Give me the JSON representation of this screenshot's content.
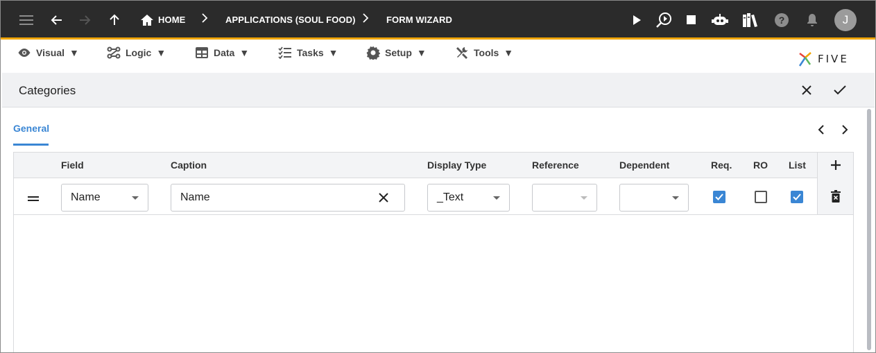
{
  "topbar": {
    "breadcrumbs": [
      "HOME",
      "APPLICATIONS (SOUL FOOD)",
      "FORM WIZARD"
    ],
    "avatar_initial": "J",
    "accent": "#f0a500"
  },
  "menu": {
    "items": [
      {
        "label": "Visual",
        "icon": "eye-icon"
      },
      {
        "label": "Logic",
        "icon": "logic-icon"
      },
      {
        "label": "Data",
        "icon": "table-icon"
      },
      {
        "label": "Tasks",
        "icon": "tasks-icon"
      },
      {
        "label": "Setup",
        "icon": "gear-icon"
      },
      {
        "label": "Tools",
        "icon": "tools-icon"
      }
    ],
    "logo_text": "FIVE"
  },
  "panel": {
    "title": "Categories",
    "tab": "General"
  },
  "grid": {
    "columns": [
      "Field",
      "Caption",
      "Display Type",
      "Reference",
      "Dependent",
      "Req.",
      "RO",
      "List"
    ],
    "rows": [
      {
        "field": "Name",
        "caption": "Name",
        "display_type": "_Text",
        "reference": "",
        "dependent": "",
        "req": true,
        "ro": false,
        "list": true
      }
    ]
  }
}
